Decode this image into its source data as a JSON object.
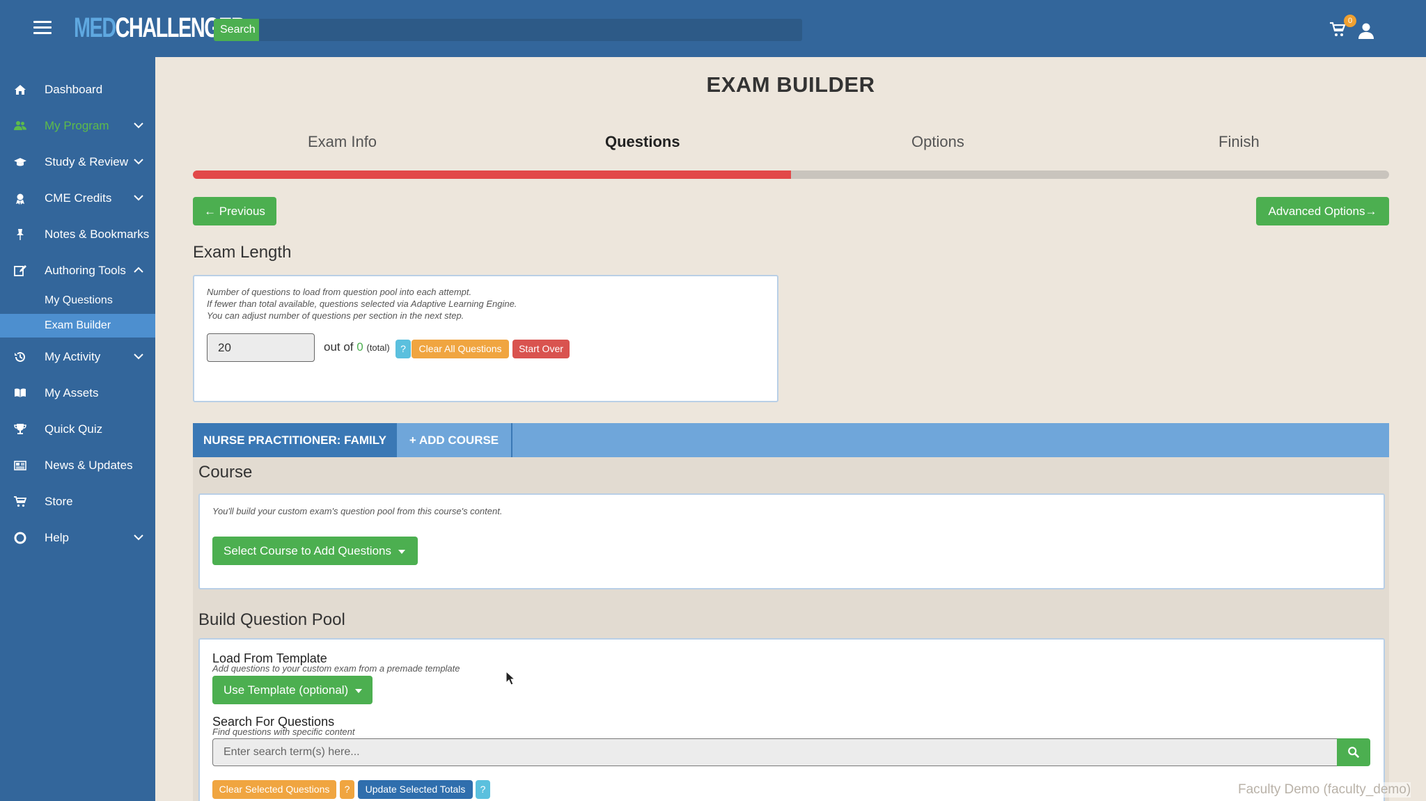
{
  "header": {
    "logo_med": "MED",
    "logo_challenger": "CHALLENGER",
    "search_label": "Search",
    "cart_count": "0"
  },
  "sidebar": {
    "items": [
      {
        "label": "Dashboard",
        "icon": "home-icon"
      },
      {
        "label": "My Program",
        "icon": "users-icon",
        "active_color": "#5dbb4a"
      },
      {
        "label": "Study & Review",
        "icon": "graduation-cap-icon"
      },
      {
        "label": "CME Credits",
        "icon": "certificate-icon"
      },
      {
        "label": "Notes & Bookmarks",
        "icon": "pushpin-icon"
      },
      {
        "label": "Authoring Tools",
        "icon": "edit-icon"
      },
      {
        "label": "My Activity",
        "icon": "history-icon"
      },
      {
        "label": "My Assets",
        "icon": "book-icon"
      },
      {
        "label": "Quick Quiz",
        "icon": "trophy-icon"
      },
      {
        "label": "News & Updates",
        "icon": "newspaper-icon"
      },
      {
        "label": "Store",
        "icon": "cart-icon"
      },
      {
        "label": "Help",
        "icon": "lifesaver-icon"
      }
    ],
    "authoring_sub": [
      {
        "label": "My Questions"
      },
      {
        "label": "Exam Builder",
        "active": true
      }
    ]
  },
  "main": {
    "title": "EXAM BUILDER",
    "steps": [
      "Exam Info",
      "Questions",
      "Options",
      "Finish"
    ],
    "active_step": "Questions",
    "progress_fraction": 0.5,
    "previous_label": "← Previous",
    "advanced_label": "Advanced Options→",
    "exam_length": {
      "heading": "Exam Length",
      "hint_lines": [
        "Number of questions to load from question pool into each attempt.",
        "If fewer than total available, questions selected via Adaptive Learning Engine.",
        "You can adjust number of questions per section in the next step."
      ],
      "count_value": "20",
      "out_of_label": "out of",
      "out_of_value": "0",
      "total_label": "(total)",
      "help_label": "?",
      "clear_all_label": "Clear All Questions",
      "start_over_label": "Start Over"
    },
    "tabs": [
      {
        "label": "NURSE PRACTITIONER: FAMILY"
      },
      {
        "label": "+ ADD COURSE"
      }
    ],
    "course": {
      "heading": "Course",
      "hint": "You'll build your custom exam's question pool from this course's content.",
      "select_label": "Select Course to Add Questions"
    },
    "pool": {
      "heading": "Build Question Pool",
      "template_title": "Load From Template",
      "template_hint": "Add questions to your custom exam from a premade template",
      "template_button": "Use Template (optional)",
      "search_title": "Search For Questions",
      "search_hint": "Find questions with specific content",
      "search_placeholder": "Enter search term(s) here...",
      "clear_selected_label": "Clear Selected Questions",
      "help_label": "?",
      "update_totals_label": "Update Selected Totals"
    },
    "watermark": "Faculty Demo (faculty_demo)"
  },
  "colors": {
    "topbar": "#33669b",
    "accent_green": "#4caf50",
    "progress_red": "#e24848",
    "tab_blue": "#6fa6da"
  }
}
